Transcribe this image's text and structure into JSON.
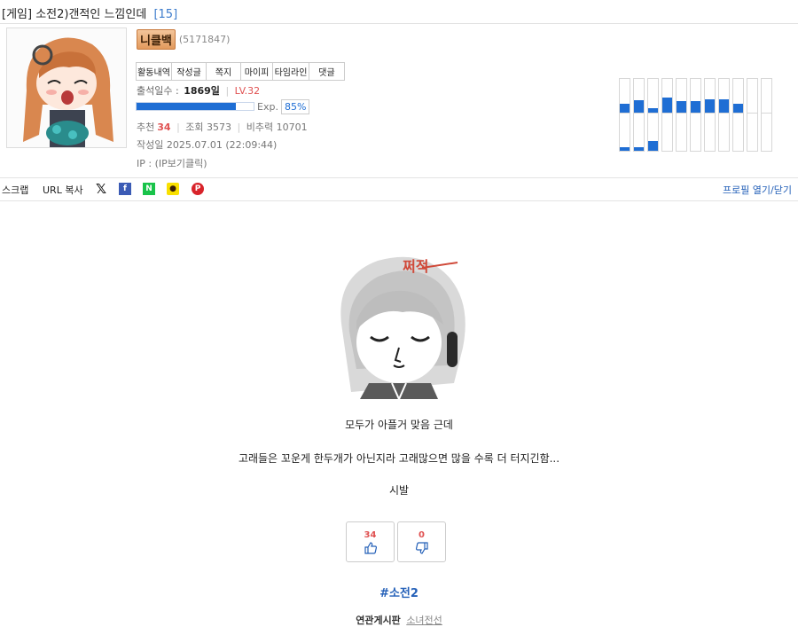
{
  "post": {
    "title": "[게임] 소전2)갠적인 느낌인데",
    "comment_count": "[15]"
  },
  "profile": {
    "nickname": "니클백",
    "member_id": "(5171847)",
    "tabs": [
      "활동내역",
      "작성글",
      "쪽지",
      "마이피",
      "타임라인",
      "댓글"
    ],
    "attendance_label": "출석일수 :",
    "attendance_value": "1869일",
    "level": "LV.32",
    "exp_label": "Exp.",
    "exp_percent": "85%",
    "exp_fraction": 0.85,
    "recommend_label": "추천",
    "recommend_value": "34",
    "views_label": "조회",
    "views_value": "3573",
    "bichu_label": "비추력",
    "bichu_value": "10701",
    "date": "작성일 2025.07.01 (22:09:44)",
    "ip": "IP : (IP보기클릭)",
    "activity_graph": {
      "up": [
        0.25,
        0.38,
        0.12,
        0.45,
        0.35,
        0.35,
        0.4,
        0.4,
        0.25,
        0.0,
        0.0
      ],
      "down": [
        0.1,
        0.1,
        0.25,
        0.0,
        0.0,
        0.0,
        0.0,
        0.0,
        0.0,
        0.0,
        0.0
      ]
    }
  },
  "toolbar": {
    "scrap": "스크랩",
    "url_copy": "URL 복사",
    "profile_toggle": "프로필 열기/닫기",
    "share_icons": [
      "x-icon",
      "facebook-icon",
      "naver-icon",
      "kakao-icon",
      "pinterest-icon"
    ]
  },
  "content": {
    "emoticon_text": "쩌적",
    "line1": "모두가 아플거 맞음 근데",
    "line2": "고래들은 꼬운게 한두개가 아닌지라 고래많으면 많을 수록 더 터지긴함...",
    "line3": "시발"
  },
  "votes": {
    "up": "34",
    "down": "0"
  },
  "tag": "#소전2",
  "related": {
    "label": "연관게시판",
    "board": "소녀전선"
  },
  "colors": {
    "accent_blue": "#1f6ed4",
    "red": "#e05252",
    "link_blue": "#2460b8"
  }
}
